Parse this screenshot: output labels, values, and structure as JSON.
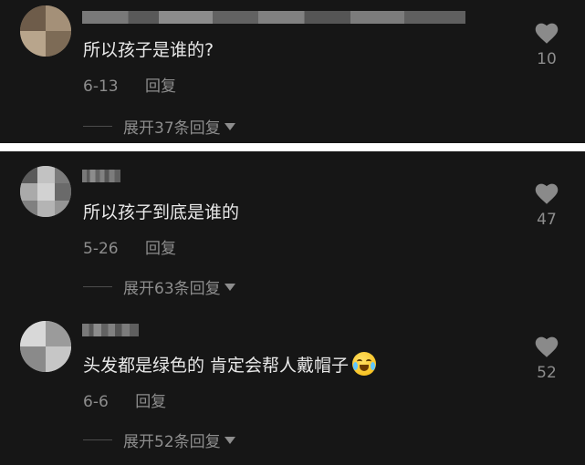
{
  "comments": [
    {
      "text": "所以孩子是谁的?",
      "date": "6-13",
      "reply_label": "回复",
      "expand_label": "展开37条回复",
      "likes": "10"
    },
    {
      "text": "所以孩子到底是谁的",
      "date": "5-26",
      "reply_label": "回复",
      "expand_label": "展开63条回复",
      "likes": "47"
    },
    {
      "text": "头发都是绿色的 肯定会帮人戴帽子",
      "date": "6-6",
      "reply_label": "回复",
      "expand_label": "展开52条回复",
      "likes": "52",
      "emoji": "laughing-crying-emoji"
    }
  ],
  "colors": {
    "background": "#161616",
    "separator": "#ffffff",
    "text_primary": "#e9e9e9",
    "text_secondary": "#8d8d8d"
  }
}
